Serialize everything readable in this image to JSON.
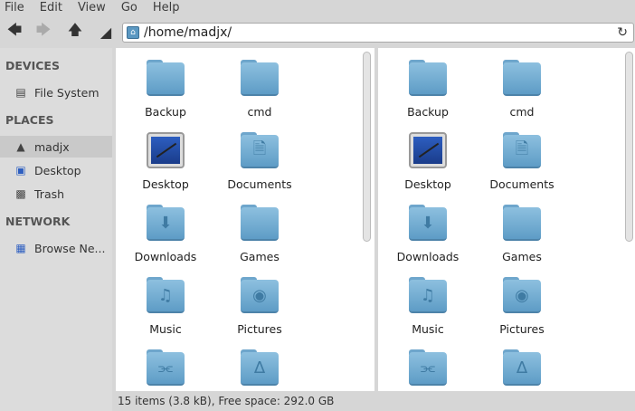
{
  "menu": [
    "File",
    "Edit",
    "View",
    "Go",
    "Help"
  ],
  "location": "/home/madjx/",
  "sidebar": {
    "devices": "DEVICES",
    "filesystem": "File System",
    "places": "PLACES",
    "home": "madjx",
    "desktop": "Desktop",
    "trash": "Trash",
    "network": "NETWORK",
    "browse": "Browse Ne..."
  },
  "items": [
    {
      "name": "Backup",
      "icon": "folder"
    },
    {
      "name": "cmd",
      "icon": "folder"
    },
    {
      "name": "Desktop",
      "icon": "desktop"
    },
    {
      "name": "Documents",
      "icon": "folder-documents"
    },
    {
      "name": "Downloads",
      "icon": "folder-downloads"
    },
    {
      "name": "Games",
      "icon": "folder"
    },
    {
      "name": "Music",
      "icon": "folder-music"
    },
    {
      "name": "Pictures",
      "icon": "folder-pictures"
    },
    {
      "name": "",
      "icon": "folder-share"
    },
    {
      "name": "",
      "icon": "folder-templates"
    }
  ],
  "status": "15 items (3.8 kB), Free space: 292.0 GB"
}
